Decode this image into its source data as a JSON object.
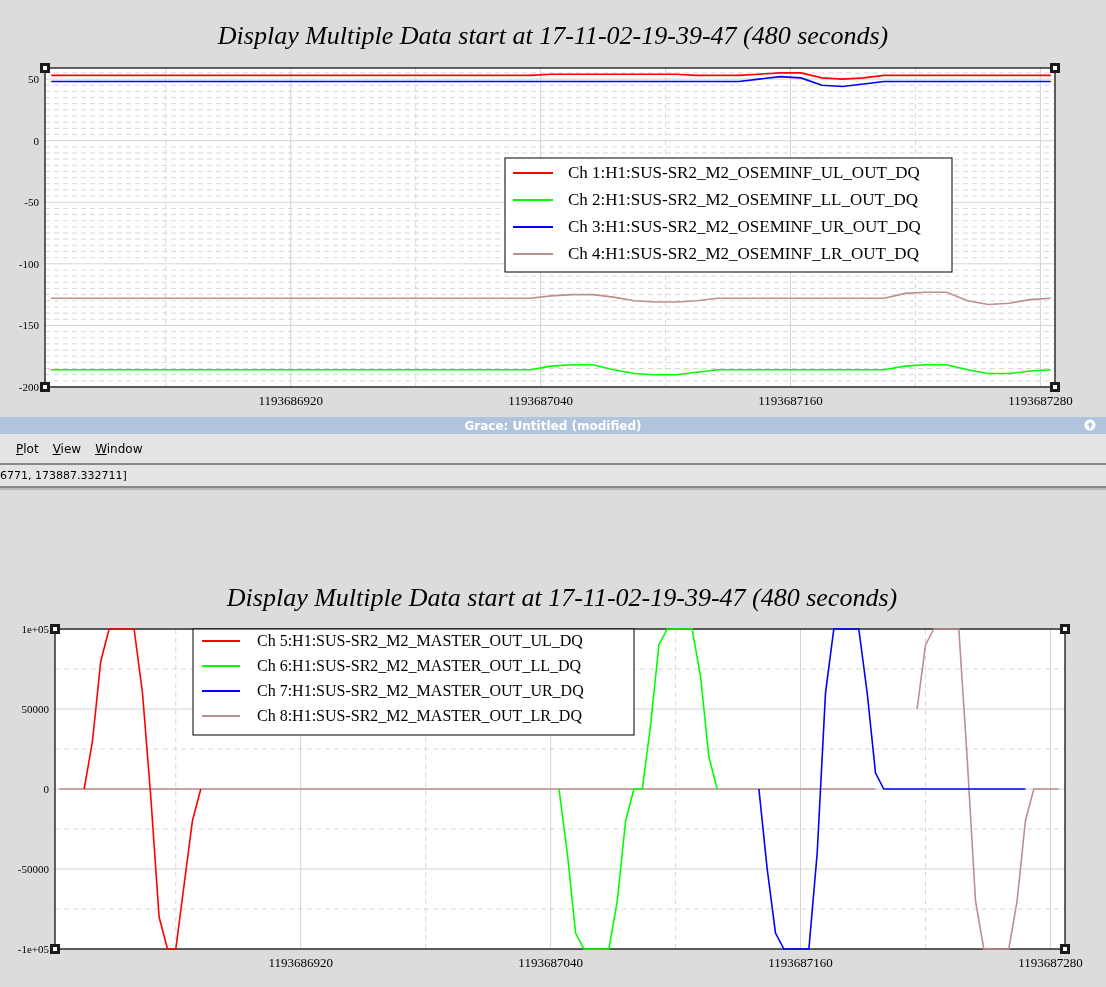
{
  "top_plot": {
    "chart_data": {
      "type": "line",
      "title": "Display Multiple Data start at 17-11-02-19-39-47 (480 seconds)",
      "x": [
        1193686805,
        1193686815,
        1193686825,
        1193686835,
        1193686845,
        1193686855,
        1193686865,
        1193686875,
        1193686885,
        1193686895,
        1193686905,
        1193686915,
        1193686925,
        1193686935,
        1193686945,
        1193686955,
        1193686965,
        1193686975,
        1193686985,
        1193686995,
        1193687005,
        1193687015,
        1193687025,
        1193687035,
        1193687045,
        1193687055,
        1193687065,
        1193687075,
        1193687085,
        1193687095,
        1193687105,
        1193687115,
        1193687125,
        1193687135,
        1193687145,
        1193687155,
        1193687165,
        1193687175,
        1193687185,
        1193687195,
        1193687205,
        1193687215,
        1193687225,
        1193687235,
        1193687245,
        1193687255,
        1193687265,
        1193687275,
        1193687285
      ],
      "series": [
        {
          "name": "Ch 1:H1:SUS-SR2_M2_OSEMINF_UL_OUT_DQ",
          "color": "#ff0000",
          "values": [
            53,
            53,
            53,
            53,
            53,
            53,
            53,
            53,
            53,
            53,
            53,
            53,
            53,
            53,
            53,
            53,
            53,
            53,
            53,
            53,
            53,
            53,
            53,
            53,
            54,
            54,
            54,
            54,
            54,
            54,
            54,
            53,
            53,
            53,
            54,
            55,
            55,
            51,
            50,
            51,
            53,
            53,
            53,
            53,
            53,
            53,
            53,
            53,
            53
          ]
        },
        {
          "name": "Ch 2:H1:SUS-SR2_M2_OSEMINF_LL_OUT_DQ",
          "color": "#00ff00",
          "values": [
            -186,
            -186,
            -186,
            -186,
            -186,
            -186,
            -186,
            -186,
            -186,
            -186,
            -186,
            -186,
            -186,
            -186,
            -186,
            -186,
            -186,
            -186,
            -186,
            -186,
            -186,
            -186,
            -186,
            -186,
            -183,
            -182,
            -182,
            -186,
            -189,
            -190,
            -190,
            -188,
            -186,
            -186,
            -186,
            -186,
            -186,
            -186,
            -186,
            -186,
            -186,
            -183,
            -182,
            -182,
            -186,
            -189,
            -189,
            -187,
            -186
          ]
        },
        {
          "name": "Ch 3:H1:SUS-SR2_M2_OSEMINF_UR_OUT_DQ",
          "color": "#0000ff",
          "values": [
            48,
            48,
            48,
            48,
            48,
            48,
            48,
            48,
            48,
            48,
            48,
            48,
            48,
            48,
            48,
            48,
            48,
            48,
            48,
            48,
            48,
            48,
            48,
            48,
            48,
            48,
            48,
            48,
            48,
            48,
            48,
            48,
            48,
            48,
            50,
            52,
            51,
            45,
            44,
            46,
            48,
            48,
            48,
            48,
            48,
            48,
            48,
            48,
            48
          ]
        },
        {
          "name": "Ch 4:H1:SUS-SR2_M2_OSEMINF_LR_OUT_DQ",
          "color": "#bc8f8f",
          "values": [
            -128,
            -128,
            -128,
            -128,
            -128,
            -128,
            -128,
            -128,
            -128,
            -128,
            -128,
            -128,
            -128,
            -128,
            -128,
            -128,
            -128,
            -128,
            -128,
            -128,
            -128,
            -128,
            -128,
            -128,
            -126,
            -125,
            -125,
            -127,
            -130,
            -131,
            -131,
            -130,
            -128,
            -128,
            -128,
            -128,
            -128,
            -128,
            -128,
            -128,
            -128,
            -124,
            -123,
            -123,
            -130,
            -133,
            -132,
            -129,
            -128
          ]
        }
      ],
      "xlim": [
        1193686802,
        1193687287
      ],
      "ylim": [
        -200,
        59
      ],
      "xticks": [
        1193686920,
        1193687040,
        1193687160,
        1193687280
      ],
      "yticks": [
        -200,
        -150,
        -100,
        -50,
        0,
        50
      ],
      "grid": true,
      "legend": true
    }
  },
  "grace_window": {
    "title": "Grace: Untitled (modified)",
    "menu": [
      "Plot",
      "View",
      "Window"
    ],
    "status": "6771, 173887.332711]"
  },
  "bottom_plot": {
    "chart_data": {
      "type": "line",
      "title": "Display Multiple Data start at 17-11-02-19-39-47 (480 seconds)",
      "x": [
        1193686804,
        1193686808,
        1193686812,
        1193686816,
        1193686820,
        1193686824,
        1193686828,
        1193686832,
        1193686836,
        1193686840,
        1193686844,
        1193686848,
        1193686852,
        1193686856,
        1193686860,
        1193686864,
        1193686868,
        1193686872,
        1193686876,
        1193686880,
        1193686884,
        1193686888,
        1193686892,
        1193686896,
        1193686900,
        1193686904,
        1193686908,
        1193686912,
        1193686916,
        1193686920,
        1193686924,
        1193686928,
        1193686932,
        1193686936,
        1193686940,
        1193686944,
        1193686948,
        1193686952,
        1193686956,
        1193686960,
        1193686964,
        1193686968,
        1193686972,
        1193686976,
        1193686980,
        1193686984,
        1193686988,
        1193686992,
        1193686996,
        1193687000,
        1193687004,
        1193687008,
        1193687012,
        1193687016,
        1193687020,
        1193687024,
        1193687028,
        1193687032,
        1193687036,
        1193687040,
        1193687044,
        1193687048,
        1193687052,
        1193687056,
        1193687060,
        1193687064,
        1193687068,
        1193687072,
        1193687076,
        1193687080,
        1193687084,
        1193687088,
        1193687092,
        1193687096,
        1193687100,
        1193687104,
        1193687108,
        1193687112,
        1193687116,
        1193687120,
        1193687124,
        1193687128,
        1193687132,
        1193687136,
        1193687140,
        1193687144,
        1193687148,
        1193687152,
        1193687156,
        1193687160,
        1193687164,
        1193687168,
        1193687172,
        1193687176,
        1193687180,
        1193687184,
        1193687188,
        1193687192,
        1193687196,
        1193687200,
        1193687204,
        1193687208,
        1193687212,
        1193687216,
        1193687220,
        1193687224,
        1193687228,
        1193687232,
        1193687236,
        1193687240,
        1193687244,
        1193687248,
        1193687252,
        1193687256,
        1193687260,
        1193687264,
        1193687268,
        1193687272,
        1193687276,
        1193687280,
        1193687284
      ],
      "series": [
        {
          "name": "Ch 5:H1:SUS-SR2_M2_MASTER_OUT_UL_DQ",
          "color": "#ff0000",
          "values": [
            null,
            null,
            null,
            0,
            30000,
            80000,
            100000,
            100000,
            100000,
            100000,
            60000,
            -5000,
            -80000,
            -100000,
            -100000,
            -60000,
            -20000,
            0,
            null,
            null,
            null,
            null,
            null,
            null,
            null,
            null,
            null,
            null,
            null,
            null,
            null,
            null,
            null,
            null,
            null,
            null,
            null,
            null,
            null,
            null,
            null,
            null,
            null,
            null,
            null,
            null,
            null,
            null,
            null,
            null,
            null,
            null,
            null,
            null,
            null,
            null,
            null,
            null,
            null,
            null,
            null,
            null,
            null,
            null,
            null,
            null,
            null,
            null,
            null,
            null,
            null,
            null,
            null,
            null,
            null,
            null,
            null,
            null,
            null,
            null,
            null,
            null,
            null,
            null,
            null,
            null,
            null,
            null,
            null,
            null,
            null,
            null,
            null,
            null,
            null,
            null,
            null,
            null,
            null,
            null,
            null,
            null,
            null,
            null,
            null,
            null,
            null,
            null,
            null,
            null,
            null,
            null,
            null,
            null,
            null,
            null,
            null,
            null,
            null,
            null,
            null
          ]
        },
        {
          "name": "Ch 6:H1:SUS-SR2_M2_MASTER_OUT_LL_DQ",
          "color": "#00ff00",
          "values": [
            null,
            null,
            null,
            null,
            null,
            null,
            null,
            null,
            null,
            null,
            null,
            null,
            null,
            null,
            null,
            null,
            null,
            null,
            null,
            null,
            null,
            null,
            null,
            null,
            null,
            null,
            null,
            null,
            null,
            null,
            null,
            null,
            null,
            null,
            null,
            null,
            null,
            null,
            null,
            null,
            null,
            null,
            null,
            null,
            null,
            null,
            null,
            null,
            null,
            null,
            null,
            null,
            null,
            null,
            null,
            null,
            null,
            null,
            null,
            null,
            0,
            -40000,
            -90000,
            -100000,
            -100000,
            -100000,
            -100000,
            -70000,
            -20000,
            0,
            0,
            40000,
            90000,
            100000,
            100000,
            100000,
            100000,
            70000,
            20000,
            0,
            null,
            null,
            null,
            null,
            null,
            null,
            null,
            null,
            null,
            null,
            null,
            null,
            null,
            null,
            null,
            null,
            null,
            null,
            null,
            null,
            null,
            null,
            null,
            null,
            null,
            null,
            null,
            null,
            null,
            null,
            null,
            null,
            null,
            null,
            null,
            null,
            null,
            null,
            null,
            null,
            null
          ]
        },
        {
          "name": "Ch 7:H1:SUS-SR2_M2_MASTER_OUT_UR_DQ",
          "color": "#0000ff",
          "values": [
            null,
            null,
            null,
            null,
            null,
            null,
            null,
            null,
            null,
            null,
            null,
            null,
            null,
            null,
            null,
            null,
            null,
            null,
            null,
            null,
            null,
            null,
            null,
            null,
            null,
            null,
            null,
            null,
            null,
            null,
            null,
            null,
            null,
            null,
            null,
            null,
            null,
            null,
            null,
            null,
            null,
            null,
            null,
            null,
            null,
            null,
            null,
            null,
            null,
            null,
            null,
            null,
            null,
            null,
            null,
            null,
            null,
            null,
            null,
            null,
            null,
            null,
            null,
            null,
            null,
            null,
            null,
            null,
            null,
            null,
            null,
            null,
            null,
            null,
            null,
            null,
            null,
            null,
            null,
            null,
            null,
            null,
            null,
            null,
            0,
            -50000,
            -90000,
            -100000,
            -100000,
            -100000,
            -100000,
            -40000,
            60000,
            100000,
            100000,
            100000,
            100000,
            60000,
            10000,
            0,
            0,
            0,
            0,
            0,
            0,
            0,
            0,
            0,
            0,
            0,
            0,
            0,
            0,
            0,
            0,
            0,
            0,
            null,
            null,
            null,
            null
          ]
        },
        {
          "name": "Ch 8:H1:SUS-SR2_M2_MASTER_OUT_LR_DQ",
          "color": "#bc8f8f",
          "values": [
            0,
            0,
            0,
            0,
            0,
            0,
            0,
            0,
            0,
            0,
            0,
            0,
            0,
            0,
            0,
            0,
            0,
            0,
            0,
            0,
            0,
            0,
            0,
            0,
            0,
            0,
            0,
            0,
            0,
            0,
            0,
            0,
            0,
            0,
            0,
            0,
            0,
            0,
            0,
            0,
            0,
            0,
            0,
            0,
            0,
            0,
            0,
            0,
            0,
            0,
            0,
            0,
            0,
            0,
            0,
            0,
            0,
            0,
            0,
            0,
            0,
            0,
            0,
            0,
            0,
            0,
            0,
            0,
            0,
            0,
            0,
            0,
            0,
            0,
            0,
            0,
            0,
            0,
            0,
            0,
            0,
            0,
            0,
            0,
            0,
            0,
            0,
            0,
            0,
            0,
            0,
            0,
            0,
            0,
            0,
            0,
            0,
            0,
            0,
            null,
            null,
            null,
            null,
            50000,
            90000,
            100000,
            100000,
            100000,
            100000,
            20000,
            -70000,
            -100000,
            -100000,
            -100000,
            -100000,
            -70000,
            -20000,
            0,
            0,
            0,
            0
          ]
        }
      ],
      "xlim": [
        1193686802,
        1193687287
      ],
      "ylim": [
        -100000,
        100000
      ],
      "xticks": [
        1193686920,
        1193687040,
        1193687160,
        1193687280
      ],
      "yticks": [
        {
          "value": -100000,
          "label": "-1e+05"
        },
        -50000,
        0,
        50000,
        {
          "value": 100000,
          "label": "1e+05"
        }
      ],
      "grid": true,
      "legend": true
    }
  }
}
